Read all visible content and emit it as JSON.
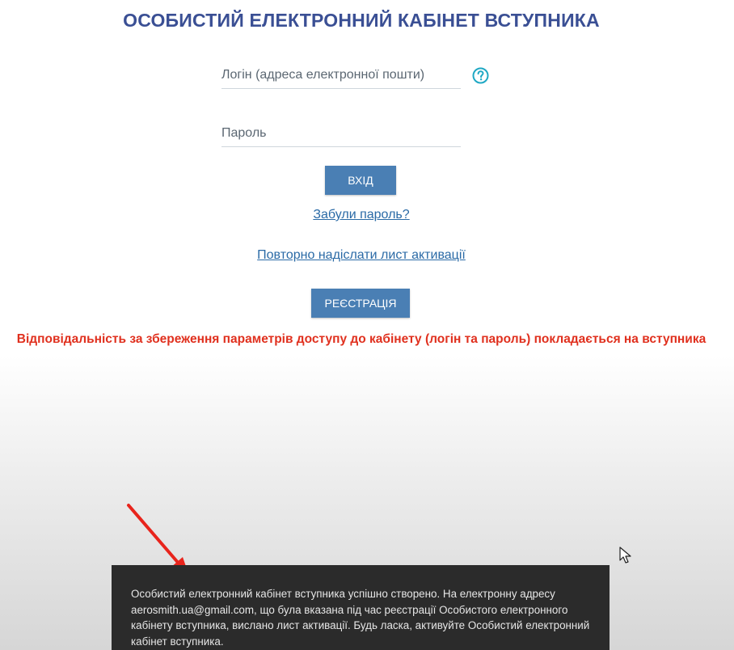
{
  "page": {
    "title": "ОСОБИСТИЙ ЕЛЕКТРОННИЙ КАБІНЕТ ВСТУПНИКА"
  },
  "login_form": {
    "login_placeholder": "Логін (адреса електронної пошти)",
    "login_value": "",
    "password_placeholder": "Пароль",
    "password_value": "",
    "help_icon": "question-circle-icon",
    "login_button": "ВХІД",
    "forgot_link": "Забули пароль?",
    "resend_link": "Повторно надіслати лист активації",
    "register_button": "РЕЄСТРАЦІЯ"
  },
  "warning": "Відповідальність за збереження параметрів доступу до кабінету (логін та пароль) покладається на вступника",
  "notification": {
    "message": "Особистий електронний кабінет вступника успішно створено. На електронну адресу aerosmith.ua@gmail.com, що була вказана під час реєстрації Особистого електронного кабінету вступника, вислано лист активації. Будь ласка, активуйте Особистий електронний кабінет вступника."
  },
  "colors": {
    "title": "#3a4f94",
    "button": "#4a7fb4",
    "link": "#2a6aa6",
    "warning": "#e0301e",
    "help_icon": "#1fa8c4",
    "toast_bg": "#2b2b2b",
    "annotation_arrow": "#e8241c"
  },
  "overlay_icons": {
    "arrow": "red-arrow-annotation-icon",
    "cursor": "mouse-pointer-icon"
  }
}
